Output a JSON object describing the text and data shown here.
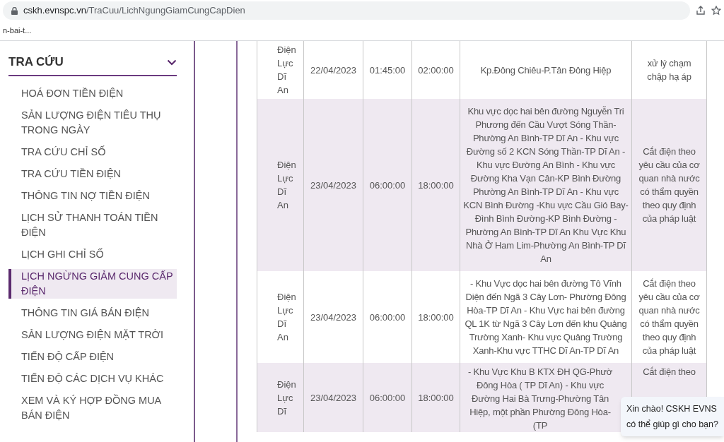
{
  "browser": {
    "url_host": "cskh.evnspc.vn",
    "url_path": "/TraCuu/LichNgungGiamCungCapDien",
    "bookmark": "n-bai-t..."
  },
  "sidebar": {
    "title": "TRA CỨU",
    "items": [
      {
        "label": "HOÁ ĐƠN TIỀN ĐIỆN",
        "selected": false
      },
      {
        "label": "SẢN LƯỢNG ĐIỆN TIÊU THỤ TRONG NGÀY",
        "selected": false
      },
      {
        "label": "TRA CỨU CHỈ SỐ",
        "selected": false
      },
      {
        "label": "TRA CỨU TIỀN ĐIỆN",
        "selected": false
      },
      {
        "label": "THÔNG TIN NỢ TIỀN ĐIỆN",
        "selected": false
      },
      {
        "label": "LỊCH SỬ THANH TOÁN TIỀN ĐIỆN",
        "selected": false
      },
      {
        "label": "LỊCH GHI CHỈ SỐ",
        "selected": false
      },
      {
        "label": "LỊCH NGỪNG GIẢM CUNG CẤP ĐIỆN",
        "selected": true
      },
      {
        "label": "THÔNG TIN GIÁ BÁN ĐIỆN",
        "selected": false
      },
      {
        "label": "SẢN LƯỢNG ĐIỆN MẶT TRỜI",
        "selected": false
      },
      {
        "label": "TIẾN ĐỘ CẤP ĐIỆN",
        "selected": false
      },
      {
        "label": "TIẾN ĐỘ CÁC DỊCH VỤ KHÁC",
        "selected": false
      },
      {
        "label": "XEM VÀ KÝ HỢP ĐỒNG MUA BÁN ĐIỆN",
        "selected": false
      }
    ]
  },
  "table": {
    "rows": [
      {
        "unit": "Điện Lực Dĩ An",
        "date": "22/04/2023",
        "start": "01:45:00",
        "end": "02:00:00",
        "area": "Kp.Đông Chiêu-P.Tân Đông Hiệp",
        "reason": "xử lý chạm chập hạ áp"
      },
      {
        "unit": "Điện Lực Dĩ An",
        "date": "23/04/2023",
        "start": "06:00:00",
        "end": "18:00:00",
        "area": "Khu vực dọc hai bên đường Nguyễn Tri Phương đến Cầu Vượt Sóng Thần-Phường An Bình-TP Dĩ An - Khu vực Đường số 2 KCN Sóng Thần-TP Dĩ An - Khu vực Đường An Bình - Khu vực Đường Kha Vạn Cân-KP Bình Đường Phường An Bình-TP Dĩ An - Khu vực KCN Bình Đường -Khu vực Cầu Gió Bay-Đình Bình Đường-KP Bình Đường -Phường An Bình-TP Dĩ An Khu Vực Khu Nhà Ở Ham Lim-Phường An Bình-TP Dĩ An",
        "reason": "Cắt điện theo yêu cầu của cơ quan nhà nước có thẩm quyền theo quy định của pháp luật"
      },
      {
        "unit": "Điện Lực Dĩ An",
        "date": "23/04/2023",
        "start": "06:00:00",
        "end": "18:00:00",
        "area": "- Khu Vực dọc hai bên đường Tô Vĩnh Diện đến Ngã 3 Cây Lơn- Phường Đông Hòa-TP Dĩ An - Khu Vực hai bên đường QL 1K từ Ngã 3 Cây Lơn đến khu Quảng Trường Xanh- Khu vực Quảng Trường Xanh-Khu vực TTHC Dĩ An-TP Dĩ An",
        "reason": "Cắt điện theo yêu cầu của cơ quan nhà nước có thẩm quyền theo quy định của pháp luật"
      },
      {
        "unit": "Điện Lực Dĩ",
        "date": "23/04/2023",
        "start": "06:00:00",
        "end": "18:00:00",
        "area": "- Khu Vực Khu B KTX ĐH QG-Phườ Đông Hòa ( TP Dĩ An) - Khu vực Đường Hai Bà Trưng-Phường Tân Hiệp, một phần Phường Đông Hòa-(TP",
        "reason": "Cắt điện theo"
      }
    ]
  },
  "chat": {
    "lines": [
      "Xin chào! CSKH EVNS",
      "có thể giúp gì cho bạn?"
    ]
  }
}
